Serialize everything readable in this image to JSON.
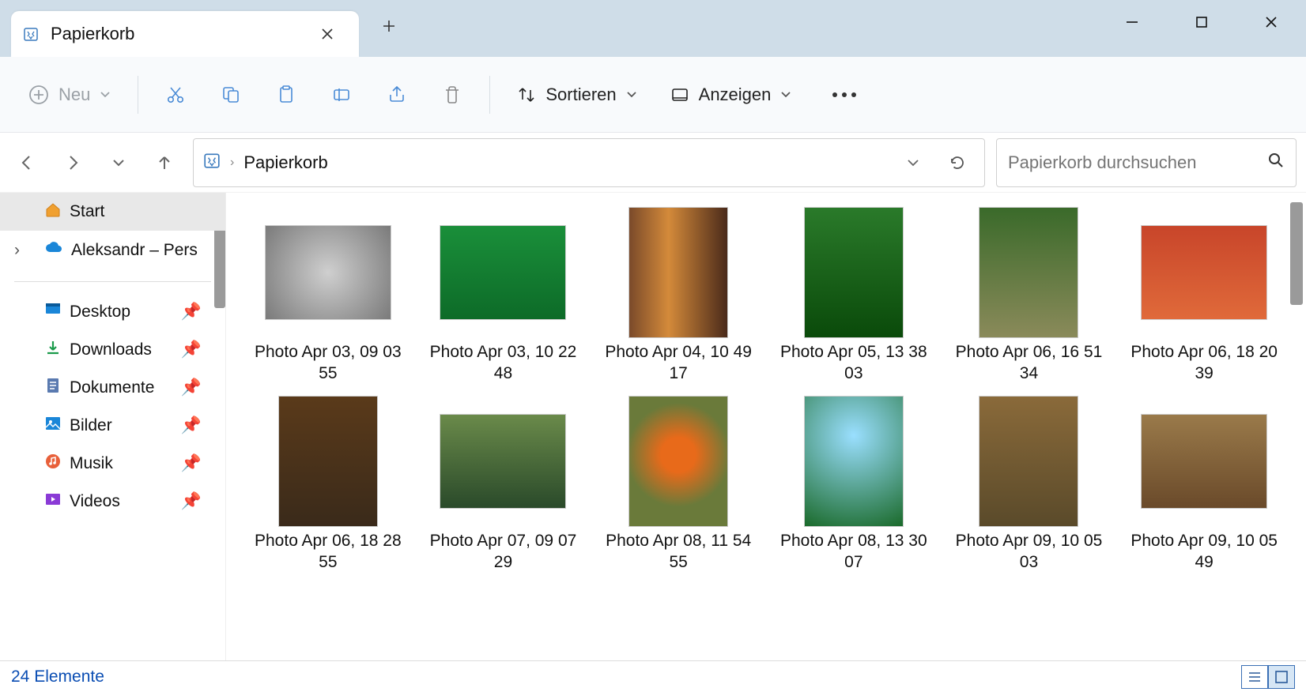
{
  "window": {
    "tab_title": "Papierkorb"
  },
  "toolbar": {
    "new_label": "Neu",
    "sort_label": "Sortieren",
    "view_label": "Anzeigen"
  },
  "breadcrumb": {
    "segment": "Papierkorb"
  },
  "search": {
    "placeholder": "Papierkorb durchsuchen"
  },
  "sidebar": {
    "start": "Start",
    "onedrive": "Aleksandr – Pers",
    "desktop": "Desktop",
    "downloads": "Downloads",
    "documents": "Dokumente",
    "pictures": "Bilder",
    "music": "Musik",
    "videos": "Videos"
  },
  "items": [
    {
      "name": "Photo Apr 03, 09 03 55",
      "orient": "landscape",
      "cls": "g1"
    },
    {
      "name": "Photo Apr 03, 10 22 48",
      "orient": "landscape",
      "cls": "g2"
    },
    {
      "name": "Photo Apr 04, 10 49 17",
      "orient": "portrait",
      "cls": "g3"
    },
    {
      "name": "Photo Apr 05, 13 38 03",
      "orient": "portrait",
      "cls": "g4"
    },
    {
      "name": "Photo Apr 06, 16 51 34",
      "orient": "portrait",
      "cls": "g5"
    },
    {
      "name": "Photo Apr 06, 18 20 39",
      "orient": "landscape",
      "cls": "g6"
    },
    {
      "name": "Photo Apr 06, 18 28 55",
      "orient": "portrait",
      "cls": "g7"
    },
    {
      "name": "Photo Apr 07, 09 07 29",
      "orient": "landscape",
      "cls": "g8"
    },
    {
      "name": "Photo Apr 08, 11 54 55",
      "orient": "portrait",
      "cls": "g9"
    },
    {
      "name": "Photo Apr 08, 13 30 07",
      "orient": "portrait",
      "cls": "g10"
    },
    {
      "name": "Photo Apr 09, 10 05 03",
      "orient": "portrait",
      "cls": "g11"
    },
    {
      "name": "Photo Apr 09, 10 05 49",
      "orient": "landscape",
      "cls": "g12"
    }
  ],
  "status": {
    "count_text": "24 Elemente"
  }
}
